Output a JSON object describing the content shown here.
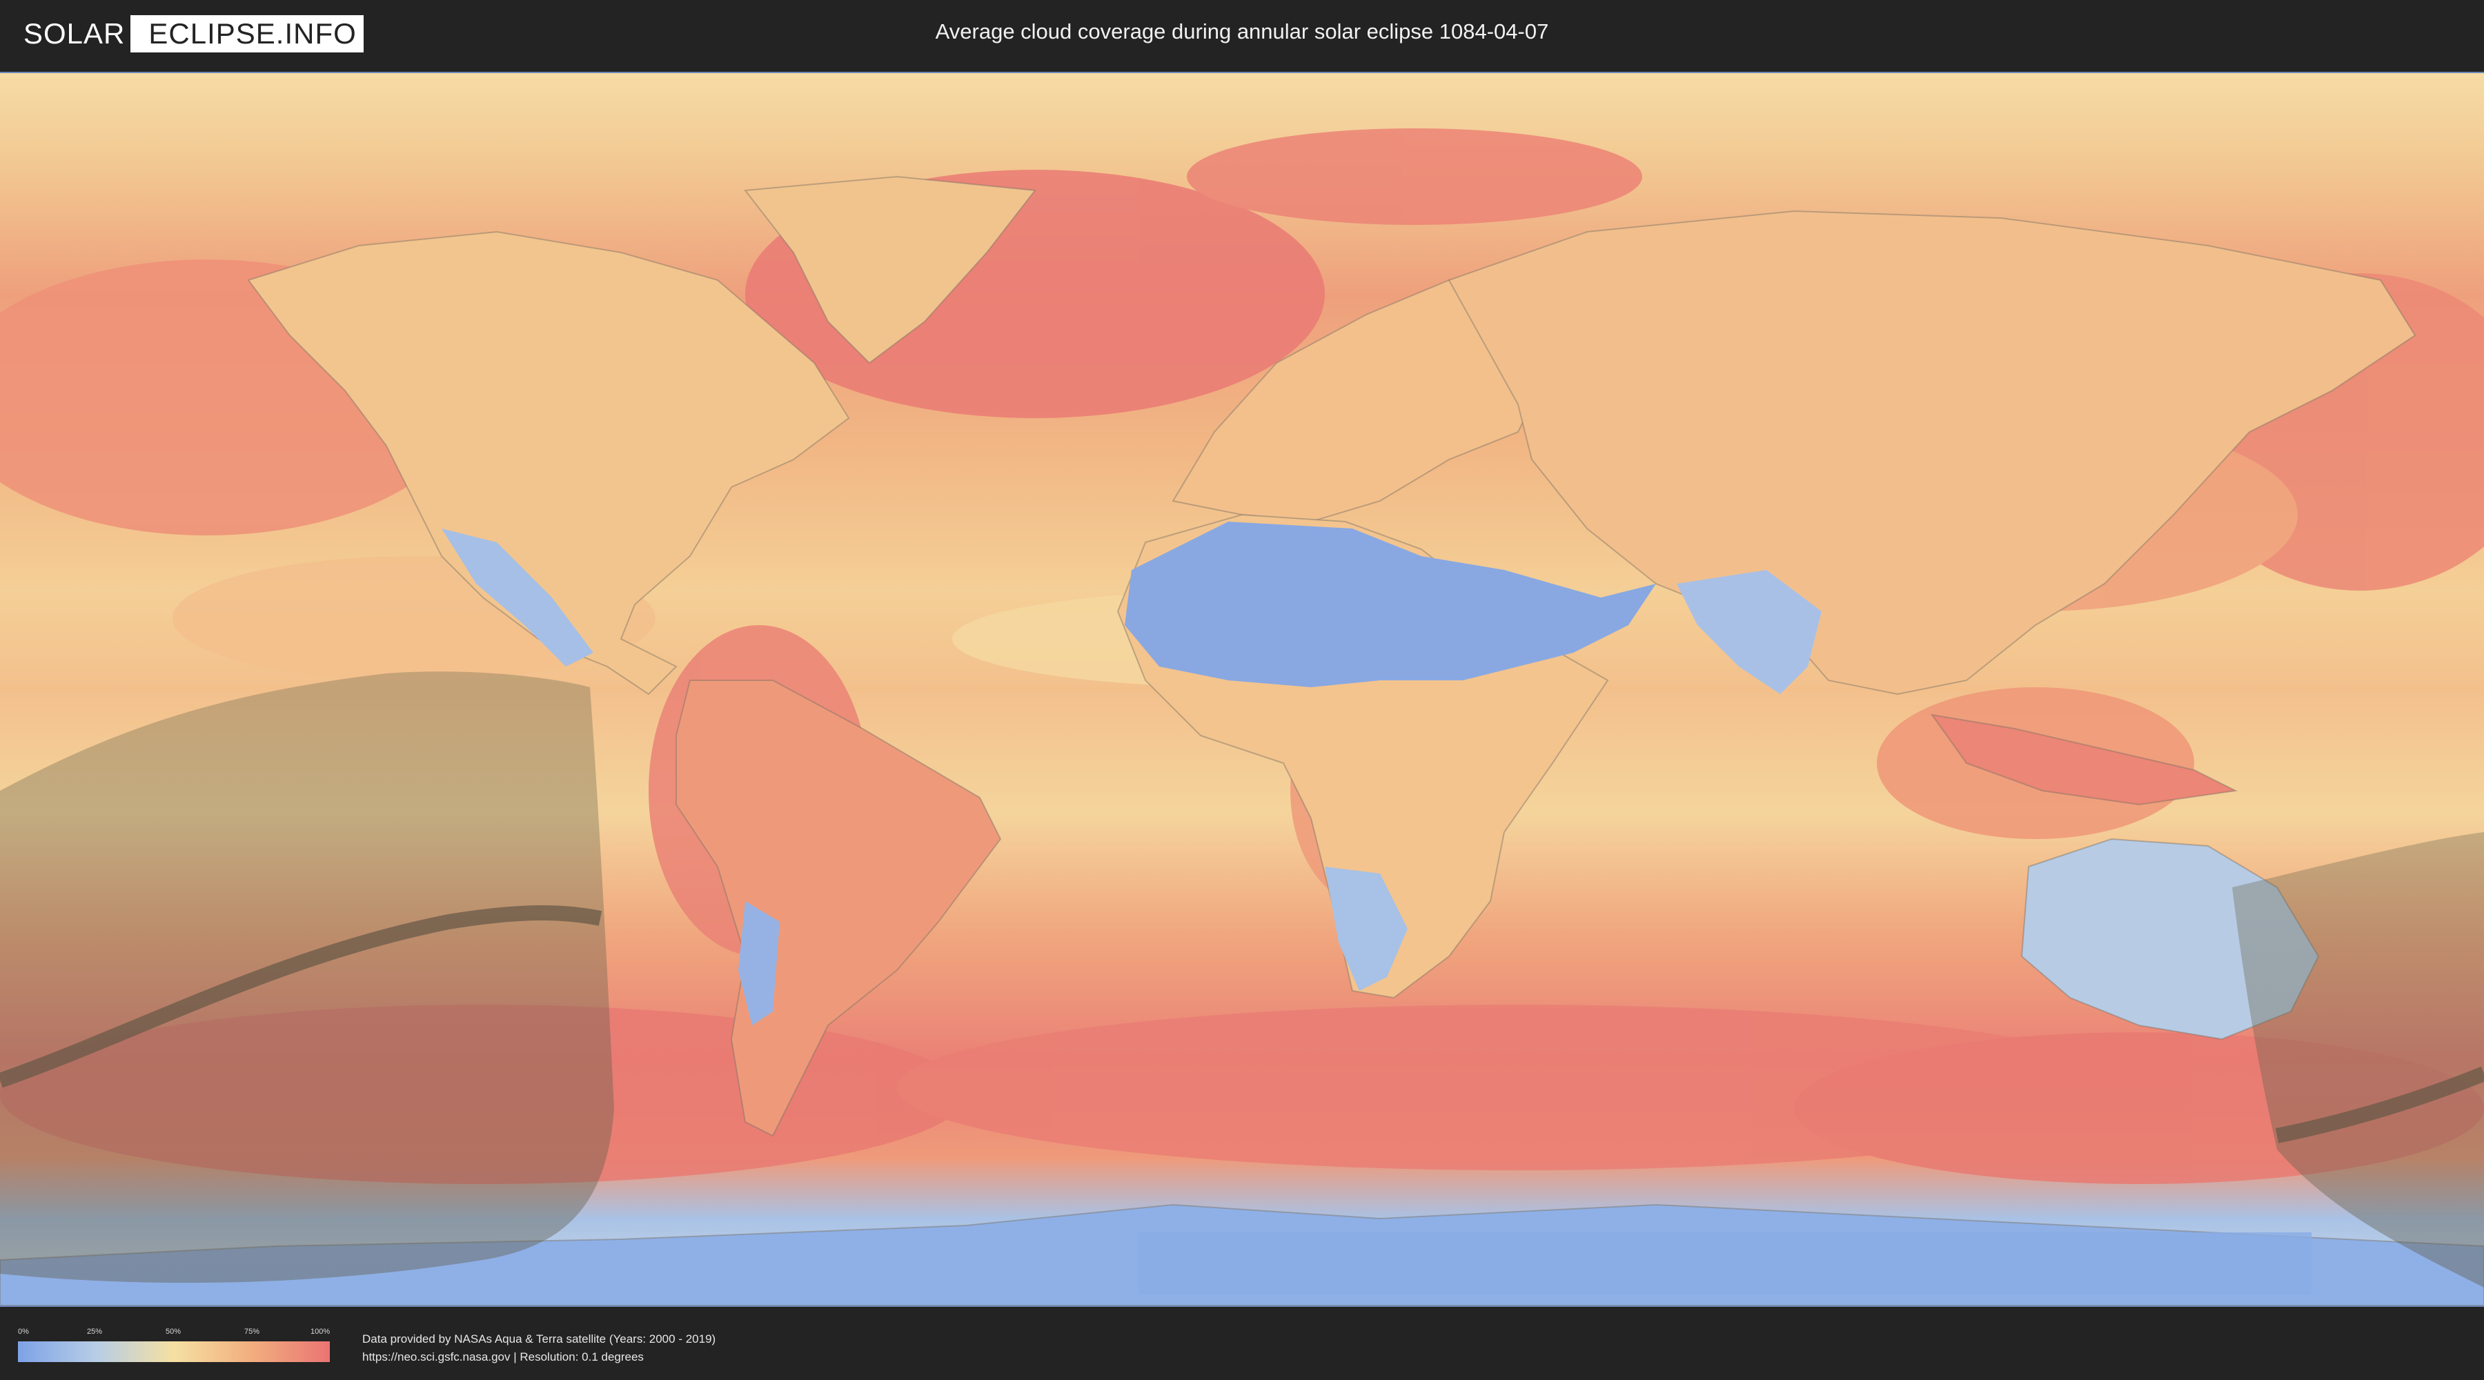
{
  "header": {
    "logo_part1": "SOLAR",
    "logo_part2": "ECLIPSE.INFO",
    "title": "Average cloud coverage during annular solar eclipse 1084-04-07"
  },
  "legend": {
    "ticks": [
      "0%",
      "25%",
      "50%",
      "75%",
      "100%"
    ],
    "colors": [
      "#7ea2e6",
      "#b7cde6",
      "#f5e0a2",
      "#f2ae7e",
      "#ea7474"
    ]
  },
  "credits": {
    "line1": "Data provided by NASAs Aqua & Terra satellite (Years: 2000 - 2019)",
    "line2": "https://neo.sci.gsfc.nasa.gov | Resolution: 0.1 degrees"
  },
  "map": {
    "projection": "equirectangular",
    "layers": [
      "cloud-coverage",
      "country-borders",
      "eclipse-visibility-zone",
      "annularity-path"
    ]
  }
}
